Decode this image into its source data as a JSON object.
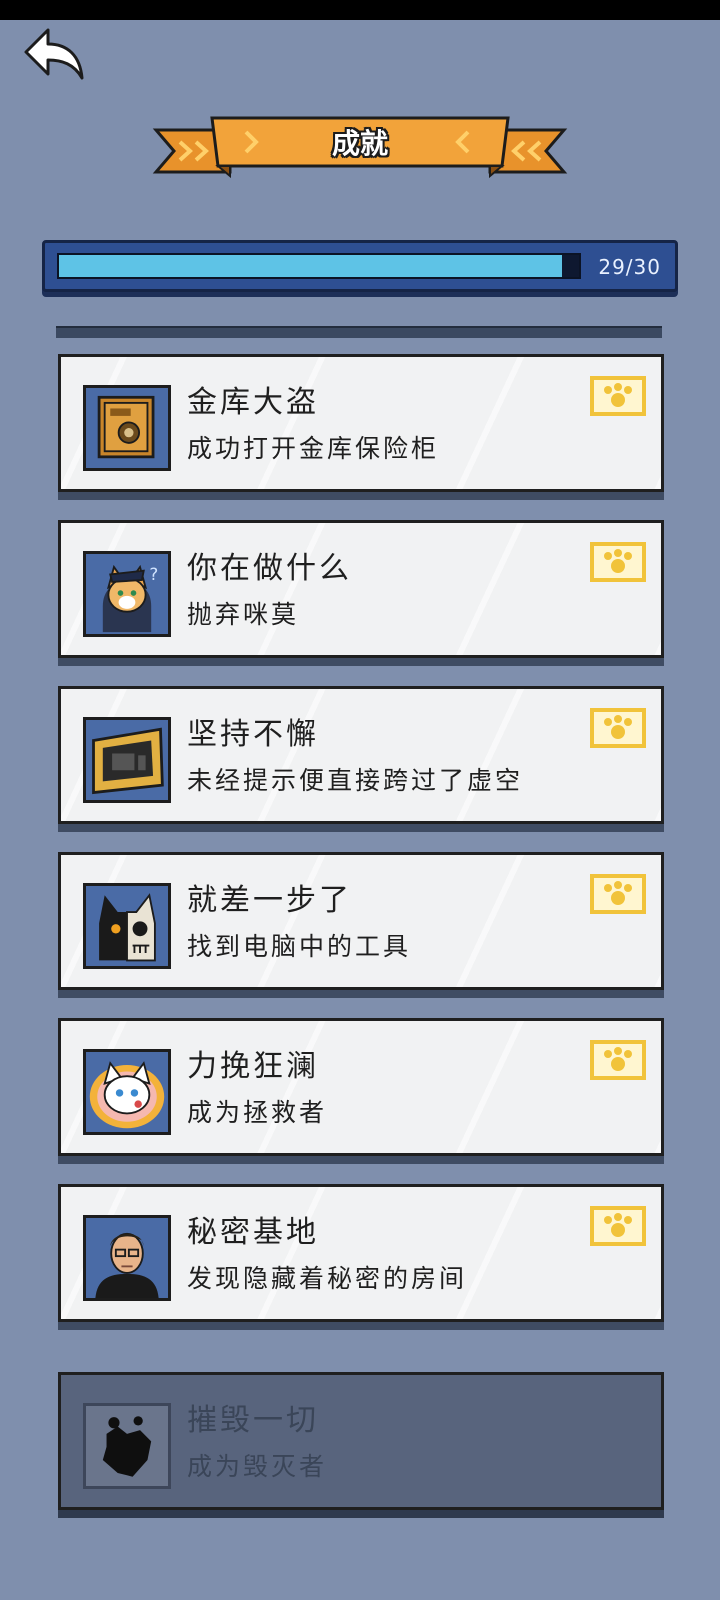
{
  "header": {
    "title": "成就"
  },
  "progress": {
    "text": "29/30",
    "fraction": 0.9667
  },
  "achievements": [
    {
      "title": "金库大盗",
      "desc": "成功打开金库保险柜",
      "icon": "safe-icon",
      "unlocked": true
    },
    {
      "title": "你在做什么",
      "desc": "抛弃咪莫",
      "icon": "cat-officer-icon",
      "unlocked": true
    },
    {
      "title": "坚持不懈",
      "desc": "未经提示便直接跨过了虚空",
      "icon": "computer-icon",
      "unlocked": true
    },
    {
      "title": "就差一步了",
      "desc": "找到电脑中的工具",
      "icon": "cat-skull-icon",
      "unlocked": true
    },
    {
      "title": "力挽狂澜",
      "desc": "成为拯救者",
      "icon": "white-cat-icon",
      "unlocked": true
    },
    {
      "title": "秘密基地",
      "desc": "发现隐藏着秘密的房间",
      "icon": "man-portrait-icon",
      "unlocked": true
    },
    {
      "title": "摧毁一切",
      "desc": "成为毁灭者",
      "icon": "rubble-icon",
      "unlocked": false
    }
  ],
  "colors": {
    "background": "#7f8fad",
    "banner": "#f2a33a",
    "progress_fill": "#5ec3e6",
    "stamp": "#f1c33a"
  }
}
